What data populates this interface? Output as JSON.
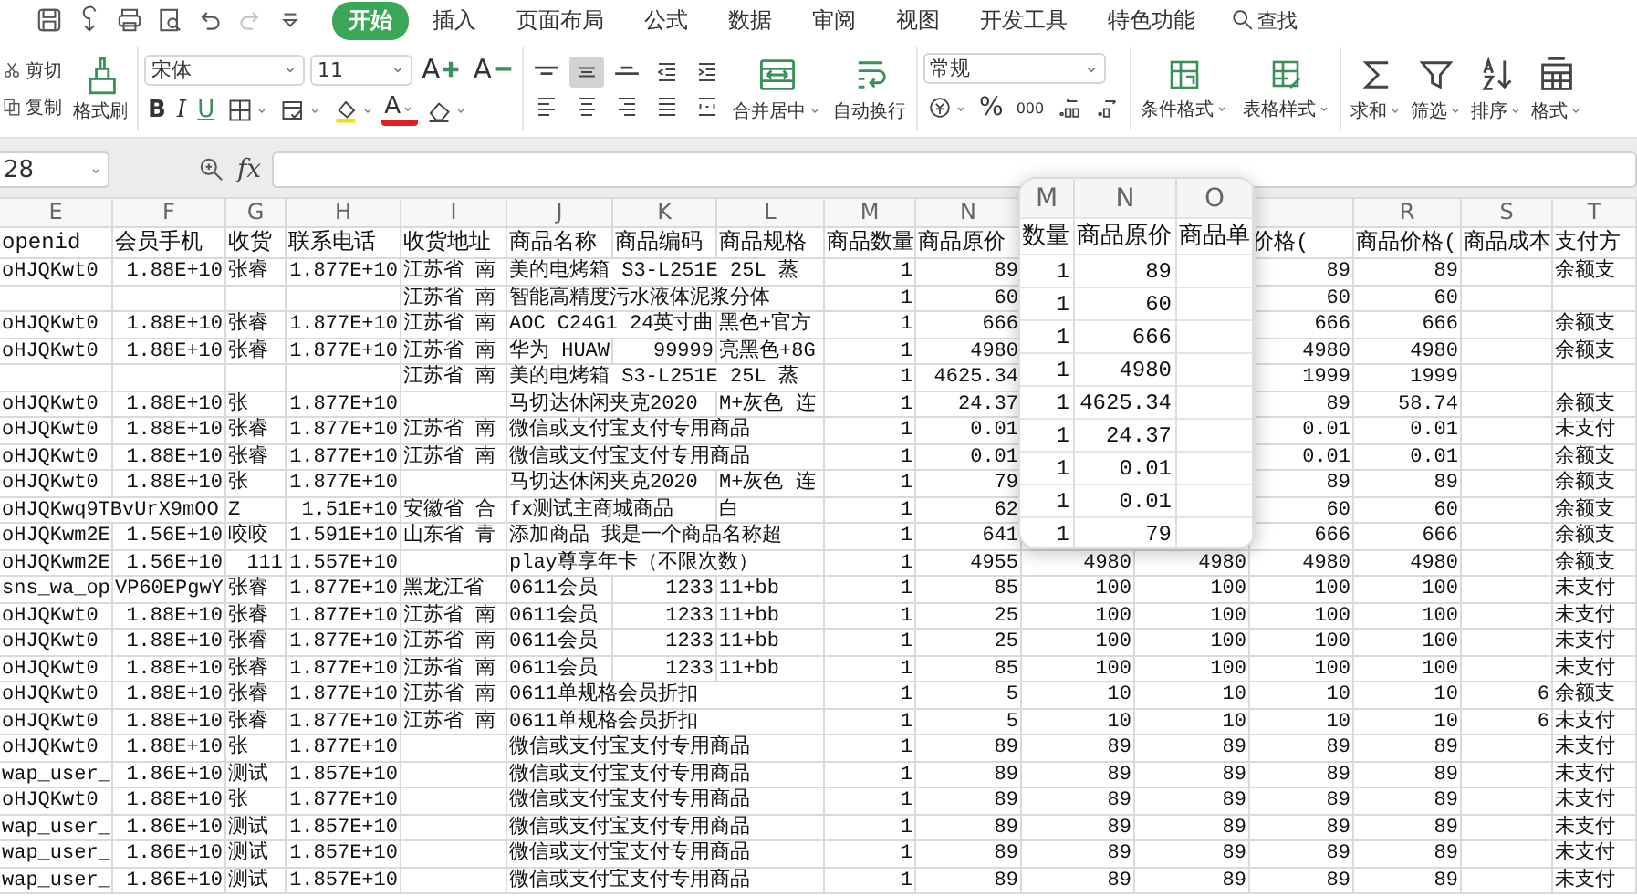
{
  "quick_access": [
    {
      "kind": "save",
      "disabled": false
    },
    {
      "kind": "hook",
      "disabled": false
    },
    {
      "kind": "print",
      "disabled": false
    },
    {
      "kind": "preview",
      "disabled": false
    },
    {
      "kind": "undo",
      "disabled": false
    },
    {
      "kind": "redo",
      "disabled": true
    },
    {
      "kind": "customize",
      "disabled": false
    }
  ],
  "tabs": [
    {
      "label": "开始",
      "selected": true
    },
    {
      "label": "插入",
      "selected": false
    },
    {
      "label": "页面布局",
      "selected": false
    },
    {
      "label": "公式",
      "selected": false
    },
    {
      "label": "数据",
      "selected": false
    },
    {
      "label": "审阅",
      "selected": false
    },
    {
      "label": "视图",
      "selected": false
    },
    {
      "label": "开发工具",
      "selected": false
    },
    {
      "label": "特色功能",
      "selected": false
    }
  ],
  "search": {
    "label": "查找"
  },
  "ribbon": {
    "clipboard": {
      "cut": "剪切",
      "copy": "复制",
      "format_painter": "格式刷"
    },
    "font": {
      "name": "宋体",
      "size": "11",
      "size_buttons": [
        {
          "kind": "grow",
          "label": "A"
        },
        {
          "kind": "shrink",
          "label": "A"
        }
      ],
      "format_buttons": [
        {
          "kind": "bold",
          "label": "B"
        },
        {
          "kind": "italic",
          "label": "I"
        },
        {
          "kind": "underline",
          "label": "U"
        },
        {
          "kind": "borders"
        },
        {
          "kind": "cell_style"
        },
        {
          "kind": "fill_color"
        },
        {
          "kind": "font_color",
          "label": "A"
        },
        {
          "kind": "clear"
        }
      ]
    },
    "alignment": {
      "buttons": [
        {
          "kind": "align_top",
          "pressed": false
        },
        {
          "kind": "align_middle",
          "pressed": true
        },
        {
          "kind": "align_bottom",
          "pressed": false
        },
        {
          "kind": "indent_decrease",
          "pressed": false
        },
        {
          "kind": "indent_increase",
          "pressed": false
        },
        {
          "kind": "align_left",
          "pressed": false
        },
        {
          "kind": "align_center",
          "pressed": false
        },
        {
          "kind": "align_right",
          "pressed": false
        },
        {
          "kind": "justify",
          "pressed": false
        },
        {
          "kind": "distributed",
          "pressed": false
        }
      ],
      "merge": "合并居中",
      "wrap": "自动换行"
    },
    "number": {
      "format": "常规",
      "buttons": [
        {
          "kind": "currency"
        },
        {
          "kind": "percent",
          "label": "%"
        },
        {
          "kind": "thousands",
          "label": "000"
        },
        {
          "kind": "inc_decimal"
        },
        {
          "kind": "dec_decimal"
        }
      ]
    },
    "styles": [
      {
        "kind": "conditional",
        "label": "条件格式"
      },
      {
        "kind": "table",
        "label": "表格样式"
      }
    ],
    "editing": [
      {
        "kind": "sum",
        "label": "求和"
      },
      {
        "kind": "filter",
        "label": "筛选"
      },
      {
        "kind": "sort",
        "label": "排序"
      },
      {
        "kind": "format",
        "label": "格式"
      }
    ]
  },
  "formula_bar": {
    "name_box": "28",
    "fx": "fx"
  },
  "sheet": {
    "columns": [
      {
        "letter": "E",
        "header": "openid"
      },
      {
        "letter": "F",
        "header": "会员手机"
      },
      {
        "letter": "G",
        "header": "收货"
      },
      {
        "letter": "H",
        "header": "联系电话"
      },
      {
        "letter": "I",
        "header": "收货地址"
      },
      {
        "letter": "J",
        "header": "商品名称"
      },
      {
        "letter": "K",
        "header": "商品编码"
      },
      {
        "letter": "L",
        "header": "商品规格"
      },
      {
        "letter": "M",
        "header": "商品数量"
      },
      {
        "letter": "N",
        "header": "商品原价"
      },
      {},
      {},
      {
        "header": "价格("
      },
      {
        "letter": "R",
        "header": "商品价格("
      },
      {
        "letter": "S",
        "header": "商品成本"
      },
      {
        "letter": "T",
        "header": "支付方"
      }
    ],
    "rows": [
      [
        "oHJQKwt0",
        "1.88E+10",
        "张睿",
        "1.877E+10",
        "江苏省 南",
        "美的电烤箱 S3-L251E 25L 蒸",
        null,
        null,
        "1",
        "89",
        null,
        null,
        "89",
        "89",
        null,
        "余额支"
      ],
      [
        null,
        null,
        null,
        null,
        "江苏省 南",
        "智能高精度污水液体泥浆分体",
        null,
        null,
        "1",
        "60",
        null,
        null,
        "60",
        "60",
        null,
        null
      ],
      [
        "oHJQKwt0",
        "1.88E+10",
        "张睿",
        "1.877E+10",
        "江苏省 南",
        "AOC C24G1 24英寸曲",
        null,
        "黑色+官方",
        "1",
        "666",
        null,
        null,
        "666",
        "666",
        null,
        "余额支"
      ],
      [
        "oHJQKwt0",
        "1.88E+10",
        "张睿",
        "1.877E+10",
        "江苏省 南",
        "华为 HUAW",
        "99999",
        "亮黑色+8G",
        "1",
        "4980",
        null,
        null,
        "4980",
        "4980",
        null,
        "余额支"
      ],
      [
        null,
        null,
        null,
        null,
        "江苏省 南",
        "美的电烤箱 S3-L251E 25L 蒸",
        null,
        null,
        "1",
        "4625.34",
        null,
        null,
        "1999",
        "1999",
        null,
        null
      ],
      [
        "oHJQKwt0",
        "1.88E+10",
        "张",
        "1.877E+10",
        null,
        "马切达休闲夹克2020",
        null,
        "M+灰色 连",
        "1",
        "24.37",
        null,
        null,
        "89",
        "58.74",
        null,
        "余额支"
      ],
      [
        "oHJQKwt0",
        "1.88E+10",
        "张睿",
        "1.877E+10",
        "江苏省 南",
        "微信或支付宝支付专用商品",
        null,
        null,
        "1",
        "0.01",
        null,
        null,
        "0.01",
        "0.01",
        null,
        "未支付"
      ],
      [
        "oHJQKwt0",
        "1.88E+10",
        "张睿",
        "1.877E+10",
        "江苏省 南",
        "微信或支付宝支付专用商品",
        null,
        null,
        "1",
        "0.01",
        null,
        null,
        "0.01",
        "0.01",
        null,
        "余额支"
      ],
      [
        "oHJQKwt0",
        "1.88E+10",
        "张",
        "1.877E+10",
        null,
        "马切达休闲夹克2020",
        null,
        "M+灰色 连",
        "1",
        "79",
        null,
        null,
        "89",
        "89",
        null,
        "余额支"
      ],
      [
        "oHJQKwq9TBvUrX9mOO",
        null,
        "Z",
        "1.51E+10",
        "安徽省 合",
        "fx测试主商城商品",
        null,
        "白",
        "1",
        "62",
        null,
        null,
        "60",
        "60",
        null,
        "余额支"
      ],
      [
        "oHJQKwm2E",
        "1.56E+10",
        "咬咬",
        "1.591E+10",
        "山东省 青",
        "添加商品 我是一个商品名称超",
        null,
        null,
        "1",
        "641",
        null,
        null,
        "666",
        "666",
        null,
        "余额支"
      ],
      [
        "oHJQKwm2E",
        "1.56E+10",
        "111",
        "1.557E+10",
        null,
        "play尊享年卡（不限次数）",
        null,
        null,
        "1",
        "4955",
        "4980",
        "4980",
        "4980",
        "4980",
        null,
        "余额支"
      ],
      [
        "sns_wa_op",
        "VP60EPgwY",
        "张睿",
        "1.877E+10",
        "黑龙江省",
        "0611会员",
        "1233",
        "11+bb",
        "1",
        "85",
        "100",
        "100",
        "100",
        "100",
        null,
        "未支付"
      ],
      [
        "oHJQKwt0",
        "1.88E+10",
        "张睿",
        "1.877E+10",
        "江苏省 南",
        "0611会员",
        "1233",
        "11+bb",
        "1",
        "25",
        "100",
        "100",
        "100",
        "100",
        null,
        "未支付"
      ],
      [
        "oHJQKwt0",
        "1.88E+10",
        "张睿",
        "1.877E+10",
        "江苏省 南",
        "0611会员",
        "1233",
        "11+bb",
        "1",
        "25",
        "100",
        "100",
        "100",
        "100",
        null,
        "未支付"
      ],
      [
        "oHJQKwt0",
        "1.88E+10",
        "张睿",
        "1.877E+10",
        "江苏省 南",
        "0611会员",
        "1233",
        "11+bb",
        "1",
        "85",
        "100",
        "100",
        "100",
        "100",
        null,
        "未支付"
      ],
      [
        "oHJQKwt0",
        "1.88E+10",
        "张睿",
        "1.877E+10",
        "江苏省 南",
        "0611单规格会员折扣",
        null,
        null,
        "1",
        "5",
        "10",
        "10",
        "10",
        "10",
        "6",
        "余额支"
      ],
      [
        "oHJQKwt0",
        "1.88E+10",
        "张睿",
        "1.877E+10",
        "江苏省 南",
        "0611单规格会员折扣",
        null,
        null,
        "1",
        "5",
        "10",
        "10",
        "10",
        "10",
        "6",
        "未支付"
      ],
      [
        "oHJQKwt0",
        "1.88E+10",
        "张",
        "1.877E+10",
        null,
        "微信或支付宝支付专用商品",
        null,
        null,
        "1",
        "89",
        "89",
        "89",
        "89",
        "89",
        null,
        "未支付"
      ],
      [
        "wap_user_",
        "1.86E+10",
        "测试",
        "1.857E+10",
        null,
        "微信或支付宝支付专用商品",
        null,
        null,
        "1",
        "89",
        "89",
        "89",
        "89",
        "89",
        null,
        "未支付"
      ],
      [
        "oHJQKwt0",
        "1.88E+10",
        "张",
        "1.877E+10",
        null,
        "微信或支付宝支付专用商品",
        null,
        null,
        "1",
        "89",
        "89",
        "89",
        "89",
        "89",
        null,
        "未支付"
      ],
      [
        "wap_user_",
        "1.86E+10",
        "测试",
        "1.857E+10",
        null,
        "微信或支付宝支付专用商品",
        null,
        null,
        "1",
        "89",
        "89",
        "89",
        "89",
        "89",
        null,
        "未支付"
      ],
      [
        "wap_user_",
        "1.86E+10",
        "测试",
        "1.857E+10",
        null,
        "微信或支付宝支付专用商品",
        null,
        null,
        "1",
        "89",
        "89",
        "89",
        "89",
        "89",
        null,
        "未支付"
      ],
      [
        "wap_user_",
        "1.86E+10",
        "测试",
        "1.857E+10",
        null,
        "微信或支付宝支付专用商品",
        null,
        null,
        "1",
        "89",
        "89",
        "89",
        "89",
        "89",
        null,
        "未支付"
      ]
    ]
  },
  "magnifier": {
    "letters": [
      "M",
      "N",
      "O"
    ],
    "headers": [
      "数量",
      "商品原价",
      "商品单"
    ],
    "rows": [
      [
        "1",
        "89"
      ],
      [
        "1",
        "60"
      ],
      [
        "1",
        "666"
      ],
      [
        "1",
        "4980"
      ],
      [
        "1",
        "4625.34"
      ],
      [
        "1",
        "24.37"
      ],
      [
        "1",
        "0.01"
      ],
      [
        "1",
        "0.01"
      ],
      [
        "1",
        "79"
      ]
    ]
  }
}
